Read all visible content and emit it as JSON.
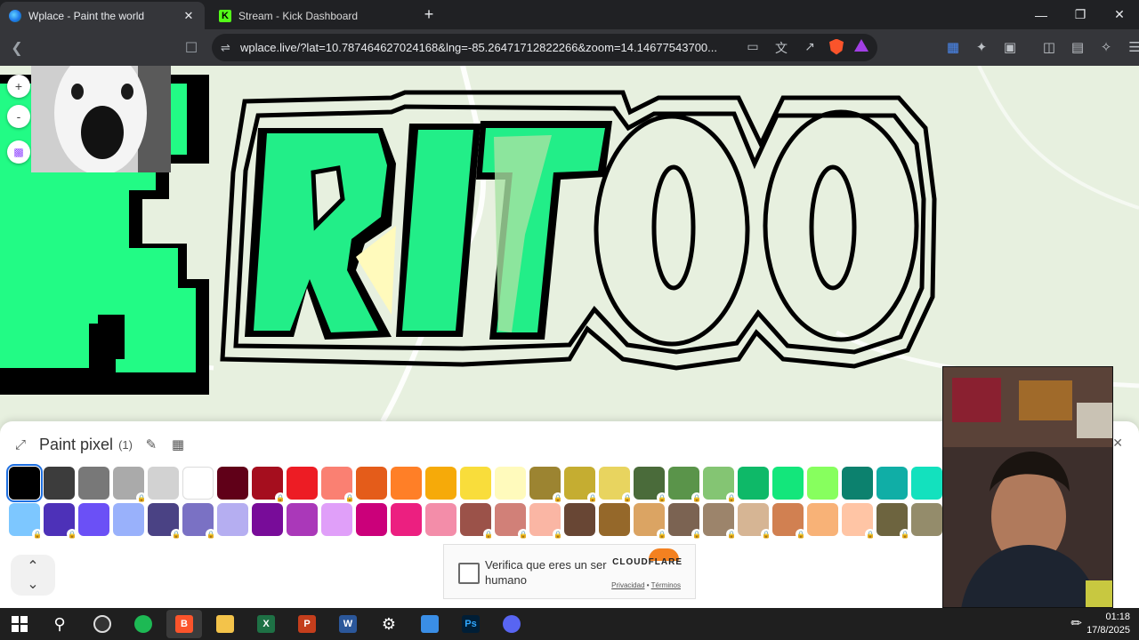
{
  "browser": {
    "tabs": [
      {
        "title": "Wplace - Paint the world",
        "icon": "globe-favicon",
        "active": true
      },
      {
        "title": "Stream - Kick Dashboard",
        "icon": "kick-favicon",
        "active": false
      }
    ],
    "url": "wplace.live/?lat=10.787464627024168&lng=-85.26471712822266&zoom=14.14677543700...",
    "kick_letter": "K"
  },
  "canvas": {
    "art_text": "RITOO",
    "zoom_in_label": "+",
    "zoom_out_label": "-"
  },
  "paint_panel": {
    "title": "Paint pixel",
    "count": "(1)",
    "selected_color": "#000000",
    "row1": [
      {
        "c": "#000000",
        "lock": false
      },
      {
        "c": "#3c3c3c",
        "lock": false
      },
      {
        "c": "#787878",
        "lock": false
      },
      {
        "c": "#aaaaaa",
        "lock": true
      },
      {
        "c": "#d2d2d2",
        "lock": false
      },
      {
        "c": "#ffffff",
        "lock": false
      },
      {
        "c": "#600018",
        "lock": false
      },
      {
        "c": "#a50e1e",
        "lock": true
      },
      {
        "c": "#ed1c24",
        "lock": false
      },
      {
        "c": "#fa8072",
        "lock": true
      },
      {
        "c": "#e45c1a",
        "lock": false
      },
      {
        "c": "#ff7f27",
        "lock": false
      },
      {
        "c": "#f6aa09",
        "lock": false
      },
      {
        "c": "#f9dd3b",
        "lock": false
      },
      {
        "c": "#fffabc",
        "lock": false
      },
      {
        "c": "#9c8431",
        "lock": true
      },
      {
        "c": "#c5ad31",
        "lock": true
      },
      {
        "c": "#e8d45f",
        "lock": true
      },
      {
        "c": "#4a6b3a",
        "lock": true
      },
      {
        "c": "#5a944a",
        "lock": true
      },
      {
        "c": "#84c573",
        "lock": true
      },
      {
        "c": "#0eb968",
        "lock": false
      },
      {
        "c": "#13e67b",
        "lock": false
      },
      {
        "c": "#87ff5e",
        "lock": false
      },
      {
        "c": "#0c816e",
        "lock": false
      },
      {
        "c": "#10aea6",
        "lock": false
      },
      {
        "c": "#13e1be",
        "lock": false
      }
    ],
    "row2": [
      {
        "c": "#7dc7ff",
        "lock": true
      },
      {
        "c": "#4d31b8",
        "lock": true
      },
      {
        "c": "#6b50f6",
        "lock": false
      },
      {
        "c": "#99b1fb",
        "lock": false
      },
      {
        "c": "#4a4284",
        "lock": true
      },
      {
        "c": "#7a71c4",
        "lock": true
      },
      {
        "c": "#b5aef1",
        "lock": false
      },
      {
        "c": "#780c99",
        "lock": false
      },
      {
        "c": "#aa38b9",
        "lock": false
      },
      {
        "c": "#e09ff9",
        "lock": false
      },
      {
        "c": "#cb007a",
        "lock": false
      },
      {
        "c": "#ec1f80",
        "lock": false
      },
      {
        "c": "#f38da9",
        "lock": false
      },
      {
        "c": "#9b5249",
        "lock": true
      },
      {
        "c": "#d18078",
        "lock": true
      },
      {
        "c": "#fab6a4",
        "lock": true
      },
      {
        "c": "#684634",
        "lock": false
      },
      {
        "c": "#95682a",
        "lock": false
      },
      {
        "c": "#dba463",
        "lock": true
      },
      {
        "c": "#7b6352",
        "lock": true
      },
      {
        "c": "#9c846b",
        "lock": true
      },
      {
        "c": "#d6b594",
        "lock": true
      },
      {
        "c": "#d18051",
        "lock": true
      },
      {
        "c": "#f8b277",
        "lock": false
      },
      {
        "c": "#ffc5a5",
        "lock": true
      },
      {
        "c": "#6d643f",
        "lock": true
      },
      {
        "c": "#948c6b",
        "lock": false
      }
    ]
  },
  "captcha": {
    "label": "Verifica que eres un ser humano",
    "brand": "CLOUDFLARE",
    "privacy": "Privacidad",
    "separator": "•",
    "terms": "Términos"
  },
  "taskbar": {
    "time": "01:18",
    "date": "17/8/2025"
  }
}
